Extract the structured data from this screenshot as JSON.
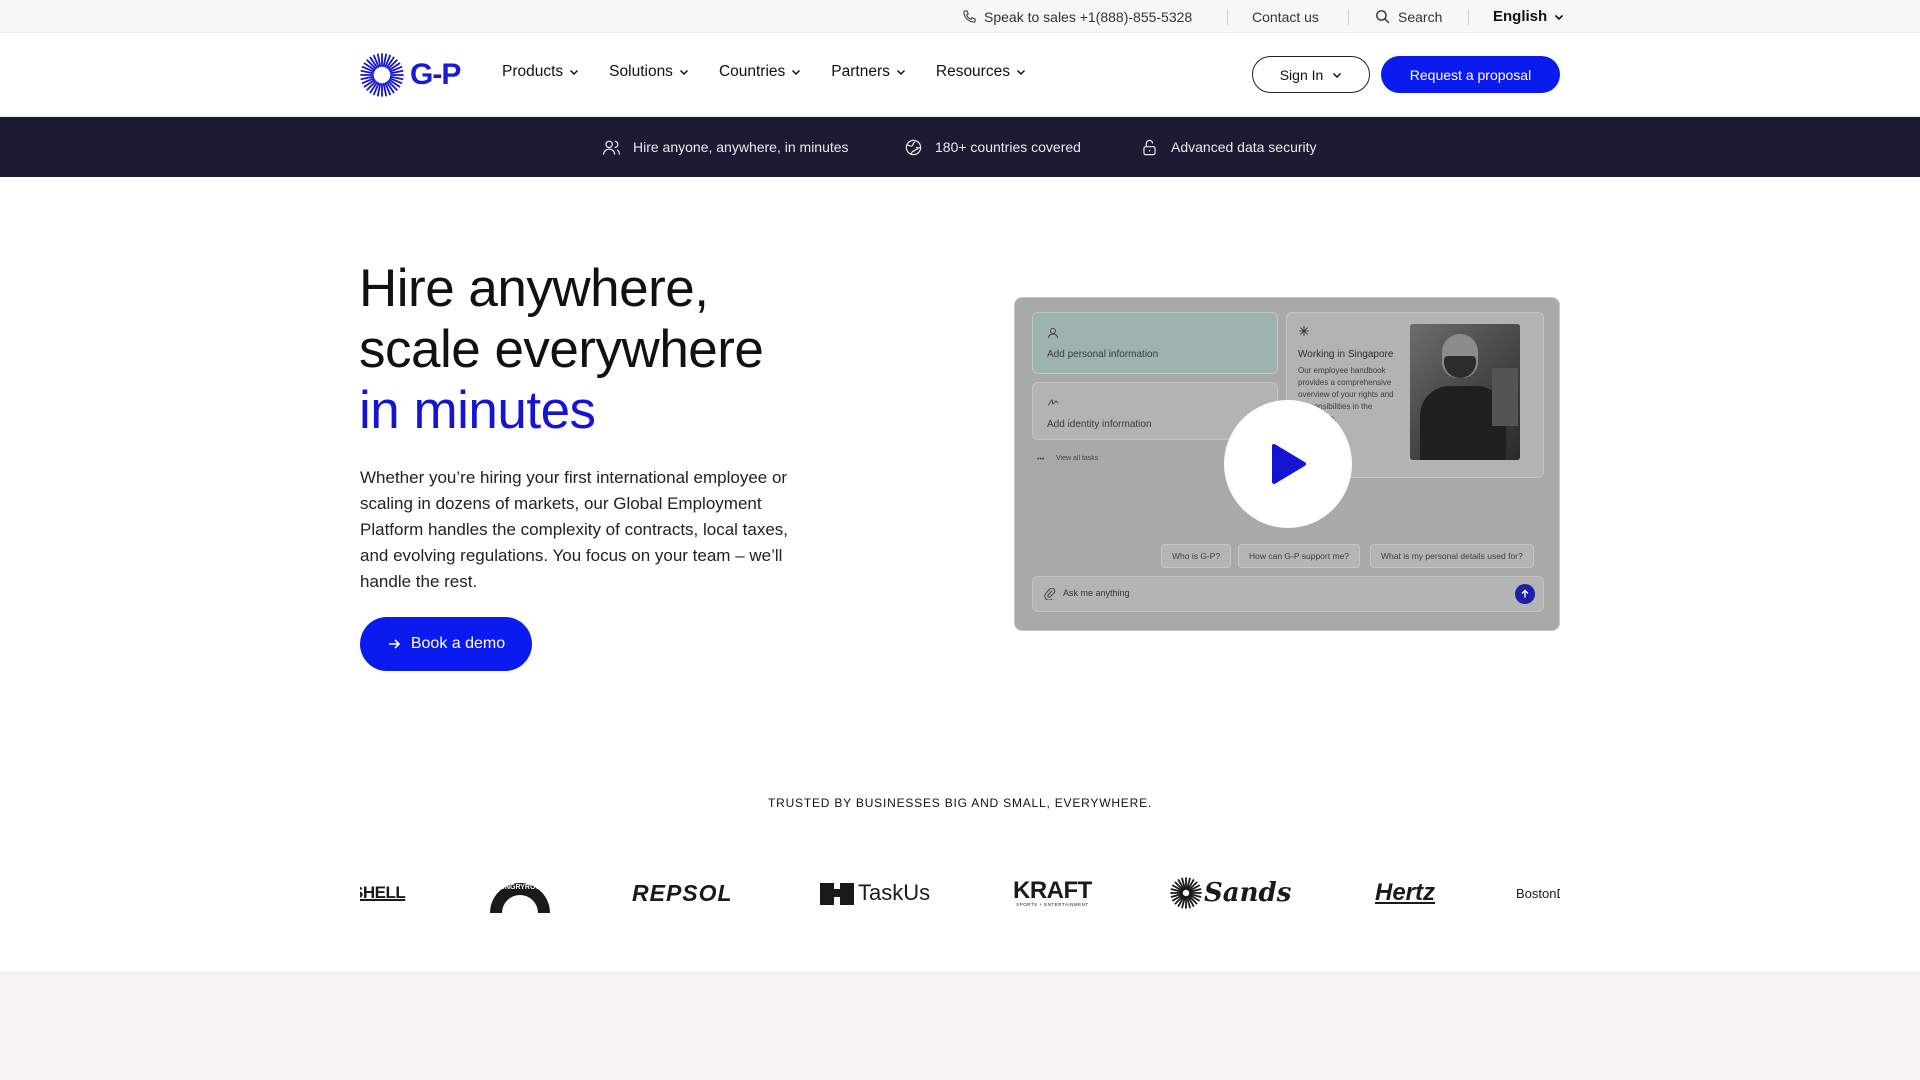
{
  "utility": {
    "sales_label": "Speak to sales +1(888)-855-5328",
    "contact_label": "Contact us",
    "search_label": "Search",
    "language": "English"
  },
  "header": {
    "logo_text": "G-P",
    "nav": [
      {
        "label": "Products"
      },
      {
        "label": "Solutions"
      },
      {
        "label": "Countries"
      },
      {
        "label": "Partners"
      },
      {
        "label": "Resources"
      }
    ],
    "signin_label": "Sign In",
    "proposal_label": "Request a proposal"
  },
  "features": [
    {
      "label": "Hire anyone, anywhere, in minutes",
      "icon": "people-icon"
    },
    {
      "label": "180+ countries covered",
      "icon": "globe-icon"
    },
    {
      "label": "Advanced data security",
      "icon": "lock-icon"
    }
  ],
  "hero": {
    "title_line1": "Hire anywhere,",
    "title_line2": "scale everywhere",
    "title_accent": "in minutes",
    "description": "Whether you’re hiring your first international employee or scaling in dozens of markets, our Global Employment Platform handles the complexity of contracts, local taxes, and evolving regulations. You focus on your team – we’ll handle the rest.",
    "cta_label": "Book a demo"
  },
  "video": {
    "card1": "Add personal information",
    "card2": "Add identity information",
    "view_all": "View all tasks",
    "card3_title": "Working in Singapore",
    "card3_body": "Our employee handbook provides a comprehensive overview of your rights and responsibilities in the workplace.",
    "chips": [
      "Who is G-P?",
      "How can G-P support me?",
      "What is my personal details used for?"
    ],
    "input_placeholder": "Ask me anything"
  },
  "trusted": {
    "heading": "TRUSTED BY BUSINESSES BIG AND SMALL, EVERYWHERE.",
    "brands": [
      "SHELL",
      "HUNGRYROOT",
      "REPSOL",
      "TaskUs",
      "KRAFT",
      "SPORTS + ENTERTAINMENT",
      "Sands",
      "Hertz",
      "BostonD"
    ]
  },
  "colors": {
    "accent": "#0b1bf0",
    "dark_bar": "#1b1c33",
    "heading_accent": "#1414d2"
  }
}
